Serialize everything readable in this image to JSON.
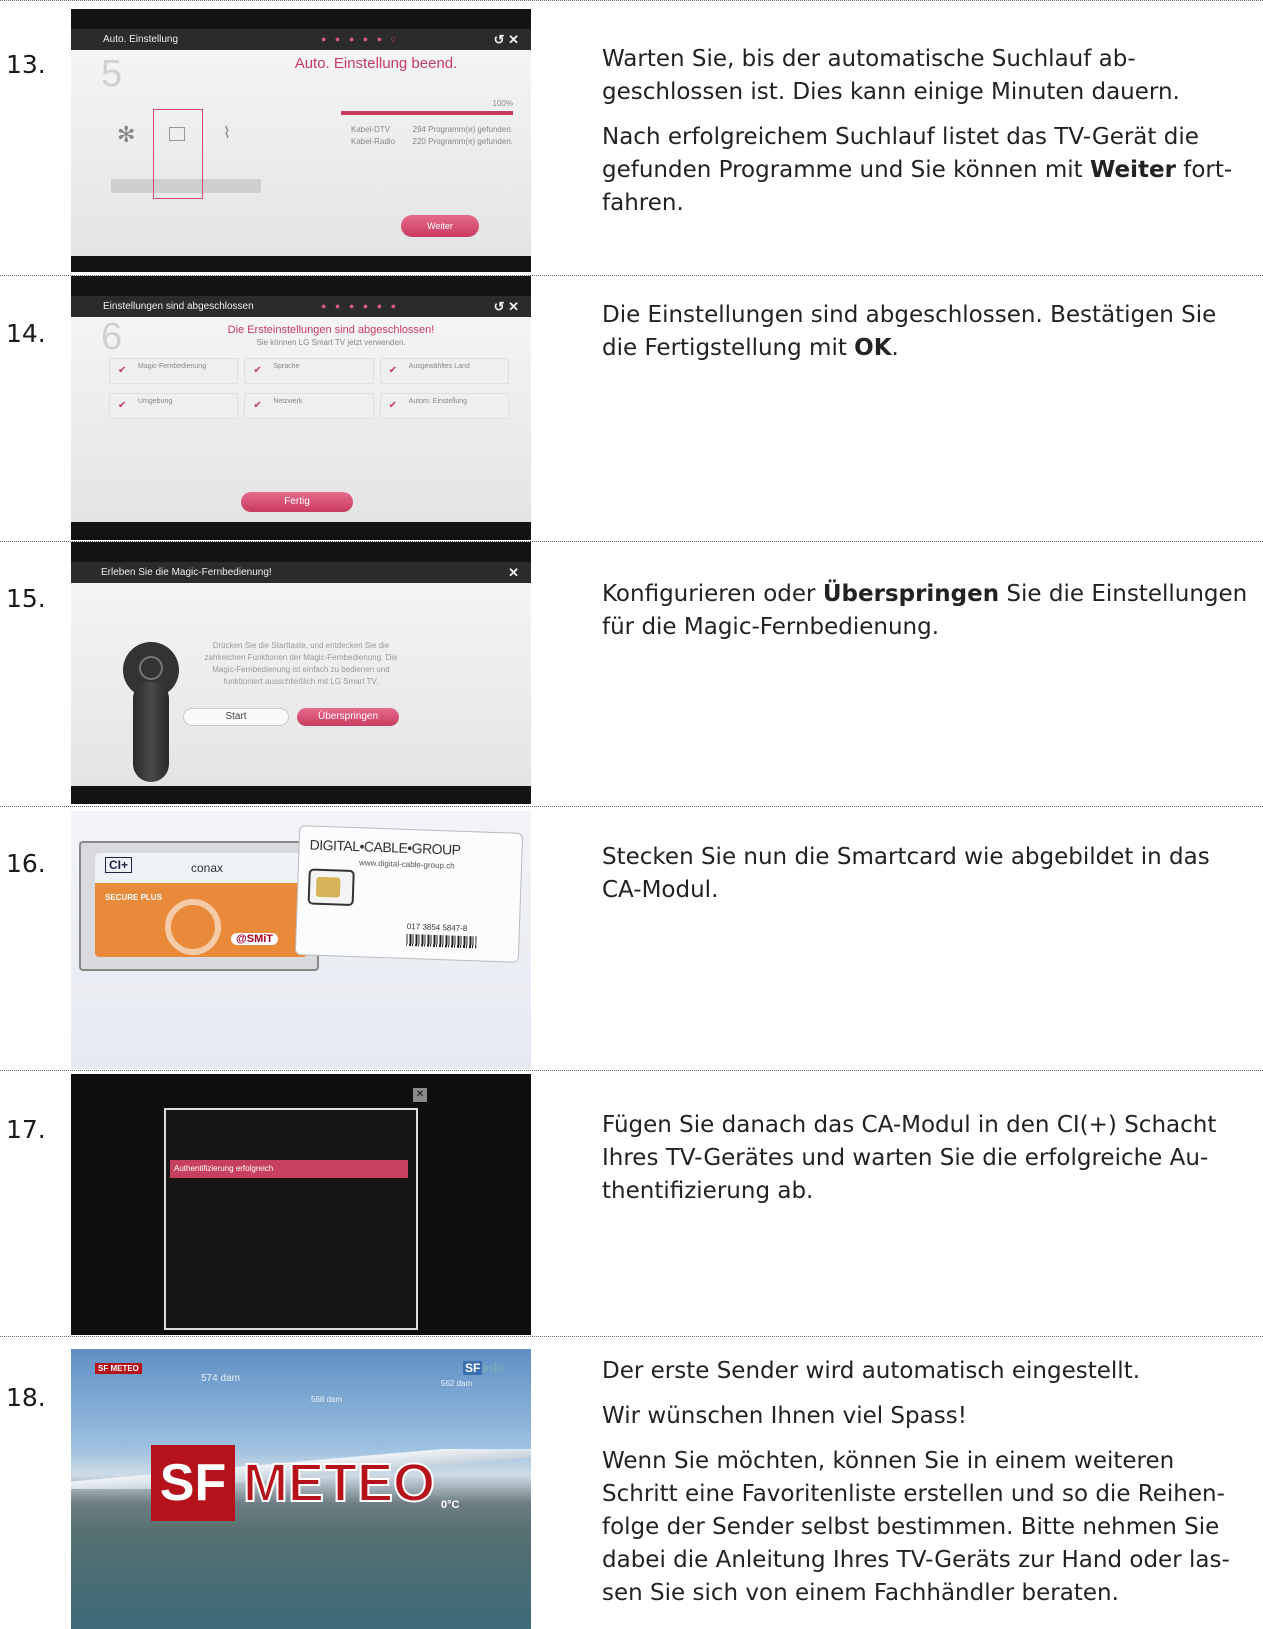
{
  "steps": [
    {
      "number": "13.",
      "screen": {
        "title": "Auto. Einstellung",
        "heading": "Auto. Einstellung beend.",
        "progress": 1.0,
        "progress_label": "100%",
        "row1_name": "Kabel-DTV",
        "row1_value": "294 Programm(e) gefunden.",
        "row2_name": "Kabel-Radio",
        "row2_value": "220 Programm(e) gefunden.",
        "button": "Weiter",
        "left_num": "5"
      },
      "p1": "Warten Sie, bis der automatische Suchlauf ab-geschlossen ist. Dies kann einige Minuten dauern.",
      "p2_before": "Nach erfolgreichem Suchlauf listet das TV-Gerät die gefunden Programme und Sie können mit ",
      "p2_bold": "Weiter",
      "p2_after": " fort-fahren."
    },
    {
      "number": "14.",
      "screen": {
        "title": "Einstellungen sind abgeschlossen",
        "heading": "Die Ersteinstellungen sind abgeschlossen!",
        "subheading": "Sie können LG Smart TV jetzt verwenden.",
        "items": [
          "Magic-Fernbedienung",
          "Sprache",
          "Ausgewähltes Land",
          "Umgebung",
          "Netzwerk",
          "Autom. Einstellung"
        ],
        "button": "Fertig",
        "left_num": "6"
      },
      "p1_before": "Die Einstellungen sind abgeschlossen. Bestätigen Sie die Fertigstellung mit ",
      "p1_bold": "OK",
      "p1_after": "."
    },
    {
      "number": "15.",
      "screen": {
        "title": "Erleben Sie die Magic-Fernbedienung!",
        "body": "Drücken Sie die Starttaste, und entdecken Sie die zahlreichen Funktionen der Magic-Fernbedienung. Die Magic-Fernbedienung ist einfach zu bedienen und funktioniert ausschließlich mit LG Smart TV.",
        "start_button": "Start",
        "skip_button": "Überspringen"
      },
      "p1_before": "Konfigurieren oder ",
      "p1_bold": "Überspringen",
      "p1_after": " Sie die Einstellungen für die Magic-Fernbedienung."
    },
    {
      "number": "16.",
      "card": {
        "ci": "CI+",
        "conax": "conax",
        "secure": "SECURE PLUS",
        "smit": "@SMiT",
        "brand": "DIGITAL•CABLE•GROUP",
        "url": "www.digital-cable-group.ch",
        "serial": "017 3854 5847-8"
      },
      "p1": "Stecken Sie nun die Smartcard wie abgebildet in das CA-Modul."
    },
    {
      "number": "17.",
      "screen": {
        "message": "Authentifizierung erfolgreich"
      },
      "p1": "Fügen Sie danach das CA-Modul in den CI(+) Schacht Ihres TV-Gerätes und warten Sie die erfolgreiche Au-thentifizierung ab."
    },
    {
      "number": "18.",
      "screen": {
        "logo": "SF METEO",
        "sf_badge": "SF",
        "info": "info",
        "dam1": "574 dam",
        "dam2": "568 dam",
        "dam3": "562 dam",
        "big_sf": "SF",
        "big_meteo": "METEO",
        "temp": "0°C"
      },
      "p1": "Der erste Sender wird automatisch eingestellt.",
      "p2": "Wir wünschen Ihnen viel Spass!",
      "p3": "Wenn Sie möchten, können Sie in einem weiteren Schritt eine Favoritenliste erstellen und so die Reihen-folge der Sender selbst bestimmen. Bitte nehmen Sie dabei die Anleitung Ihres TV-Geräts zur Hand oder las-sen Sie sich von einem Fachhändler beraten."
    }
  ]
}
